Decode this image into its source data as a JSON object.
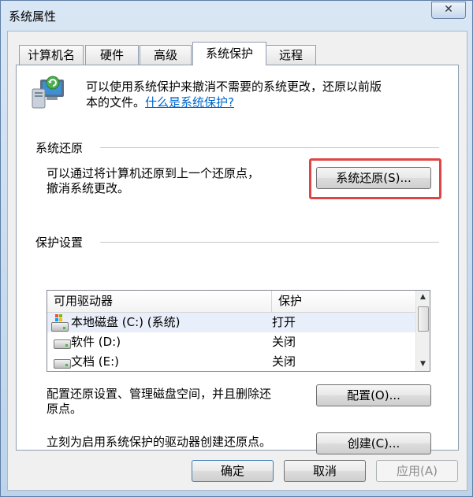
{
  "window": {
    "title": "系统属性",
    "close_symbol": "✕"
  },
  "tabs": [
    {
      "label": "计算机名"
    },
    {
      "label": "硬件"
    },
    {
      "label": "高级"
    },
    {
      "label": "系统保护"
    },
    {
      "label": "远程"
    }
  ],
  "active_tab": "系统保护",
  "intro": {
    "text_line1": "可以使用系统保护来撤消不需要的系统更改，还原以前版",
    "text_line2": "本的文件。",
    "link": "什么是系统保护?"
  },
  "restore_section": {
    "title": "系统还原",
    "desc_line1": "可以通过将计算机还原到上一个还原点，",
    "desc_line2": "撤消系统更改。",
    "button": "系统还原(S)..."
  },
  "protection_section": {
    "title": "保护设置",
    "columns": [
      "可用驱动器",
      "保护"
    ],
    "drives": [
      {
        "name": "本地磁盘 (C:) (系统)",
        "protection": "打开",
        "icon": "system-drive-icon"
      },
      {
        "name": "软件 (D:)",
        "protection": "关闭",
        "icon": "drive-icon"
      },
      {
        "name": "文档 (E:)",
        "protection": "关闭",
        "icon": "drive-icon"
      }
    ],
    "configure_text_line1": "配置还原设置、管理磁盘空间，并且删除还",
    "configure_text_line2": "原点。",
    "configure_button": "配置(O)...",
    "create_text": "立刻为启用系统保护的驱动器创建还原点。",
    "create_button": "创建(C)..."
  },
  "footer": {
    "ok": "确定",
    "cancel": "取消",
    "apply": "应用(A)"
  },
  "colors": {
    "highlight": "#e04545",
    "link": "#0066cc"
  }
}
